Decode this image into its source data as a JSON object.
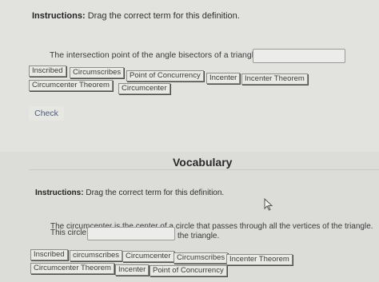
{
  "section1": {
    "instructions_label": "Instructions:",
    "instructions_text": "Drag the correct term for this definition.",
    "sentence": "The intersection point of the angle bisectors of a triangle.",
    "blank_value": "",
    "terms": [
      "Inscribed",
      "Circumscribes",
      "Point of Concurrency",
      "Incenter",
      "Incenter Theorem",
      "Circumcenter Theorem",
      "Circumcenter"
    ],
    "check_label": "Check"
  },
  "section2": {
    "heading": "Vocabulary",
    "instructions_label": "Instructions:",
    "instructions_text": "Drag the correct term for this definition.",
    "sentence_line1": "The circumcenter is the center of a circle that passes through all the vertices of the triangle.",
    "sentence_prefix": "This circle",
    "sentence_suffix": "the triangle.",
    "blank_value": "",
    "terms": [
      "Inscribed",
      "circumscribes",
      "Circumcenter",
      "Circumscribes",
      "Incenter Theorem",
      "Circumcenter Theorem",
      "Incenter",
      "Point of Concurrency"
    ]
  },
  "icons": {
    "cursor": "mouse-pointer-icon"
  }
}
